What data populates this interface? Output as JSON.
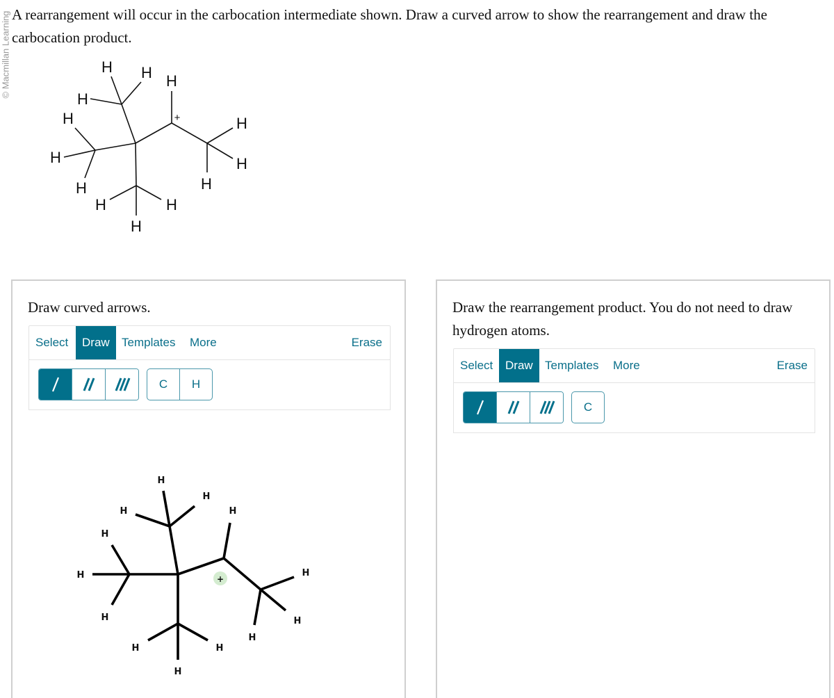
{
  "watermark": "© Macmillan Learning",
  "question": "A rearrangement will occur in the carbocation intermediate shown. Draw a curved arrow to show the rearrangement and draw the carbocation product.",
  "structure": {
    "atom_label": "H",
    "charge": "+"
  },
  "left_panel": {
    "prompt": "Draw curved arrows.",
    "tabs": [
      {
        "label": "Select",
        "active": false
      },
      {
        "label": "Draw",
        "active": true
      },
      {
        "label": "Templates",
        "active": false
      },
      {
        "label": "More",
        "active": false
      }
    ],
    "erase_label": "Erase",
    "bond_tools": [
      {
        "name": "single-bond",
        "active": true
      },
      {
        "name": "double-bond",
        "active": false
      },
      {
        "name": "triple-bond",
        "active": false
      }
    ],
    "atom_tools": [
      "C",
      "H"
    ],
    "canvas": {
      "atom_label": "H",
      "charge": "+"
    }
  },
  "right_panel": {
    "prompt": "Draw the rearrangement product. You do not need to draw hydrogen atoms.",
    "tabs": [
      {
        "label": "Select",
        "active": false
      },
      {
        "label": "Draw",
        "active": true
      },
      {
        "label": "Templates",
        "active": false
      },
      {
        "label": "More",
        "active": false
      }
    ],
    "erase_label": "Erase",
    "bond_tools": [
      {
        "name": "single-bond",
        "active": true
      },
      {
        "name": "double-bond",
        "active": false
      },
      {
        "name": "triple-bond",
        "active": false
      }
    ],
    "atom_tools": [
      "C"
    ]
  },
  "colors": {
    "accent": "#02708b",
    "accent_text": "#0a6f8a",
    "panel_border": "#cfcfcf",
    "charge_badge": "#d4ecd0"
  }
}
